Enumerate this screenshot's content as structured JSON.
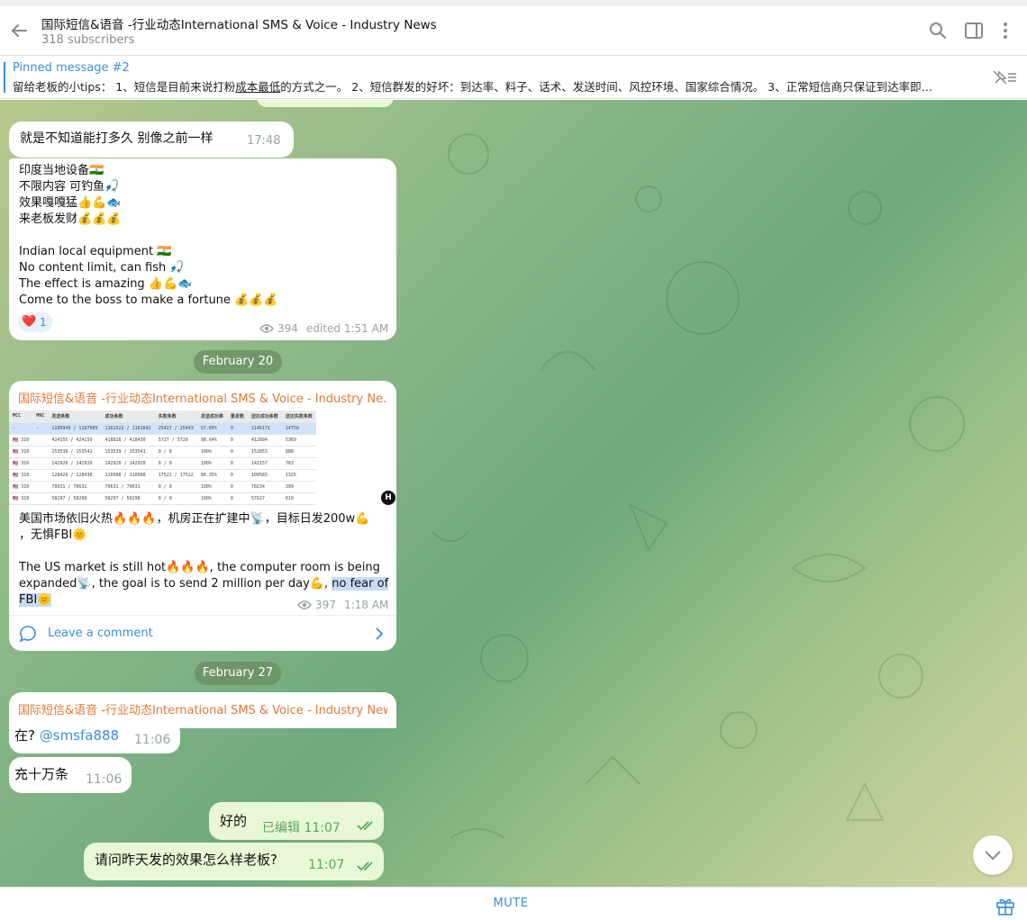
{
  "header": {
    "title": "国际短信&语音 -行业动态International SMS & Voice - Industry News",
    "subscribers": "318 subscribers"
  },
  "pinned": {
    "label": "Pinned message #2",
    "text_before": "留给老板的小tips： 1、短信是目前来说打粉",
    "text_underlined": "成本最低",
    "text_after": "的方式之一。 2、短信群发的好坏：到达率、料子、话术、发送时间、风控环境、国家综合情况。 3、正常短信商只保证到达率即…"
  },
  "messages": {
    "m0": {
      "text": "就是不知道能打多久 别像之前一样",
      "time": "17:48"
    },
    "m1": {
      "lines": [
        "印度当地设备🇮🇳",
        "不限内容 可钓鱼🎣",
        "效果嘎嘎猛👍💪🐟",
        "来老板发财💰💰💰",
        "Indian local equipment 🇮🇳",
        "No content limit, can fish 🎣",
        "The effect is amazing 👍💪🐟",
        "Come to the boss to make a fortune 💰💰💰"
      ],
      "reaction_emoji": "❤️",
      "reaction_count": "1",
      "views": "394",
      "meta": "edited 1:51 AM"
    },
    "date1": "February 20",
    "m2": {
      "channel": "国际短信&语音 -行业动态International SMS & Voice - Industry Ne...",
      "table_header": [
        "MCC",
        "MNC",
        "发送条数",
        "成功条数",
        "失败条数",
        "发送成功率",
        "重发数",
        "送达成功条数",
        "送达失败条数"
      ],
      "table_rows": [
        [
          "-",
          "-",
          "1186949 / 1187085",
          "1161522 / 1161642",
          "25427 / 25443",
          "97.85%",
          "0",
          "1146171",
          "14750"
        ],
        [
          "🇺🇸 310",
          "",
          "424155 / 424159",
          "418828 / 418430",
          "5727 / 5729",
          "98.64%",
          "0",
          "412684",
          "5369"
        ],
        [
          "🇺🇸 310",
          "",
          "153539 / 153541",
          "153539 / 153541",
          "0 / 0",
          "100%",
          "0",
          "152653",
          "888"
        ],
        [
          "🇺🇸 310",
          "",
          "142920 / 142920",
          "142920 / 142920",
          "0 / 0",
          "100%",
          "0",
          "142157",
          "763"
        ],
        [
          "🇺🇸 310",
          "",
          "128429 / 128430",
          "110908 / 110908",
          "17521 / 17522",
          "86.35%",
          "0",
          "109583",
          "1325"
        ],
        [
          "🇺🇸 310",
          "",
          "70631 / 70631",
          "70631 / 70631",
          "0 / 0",
          "100%",
          "0",
          "70234",
          "399"
        ],
        [
          "🇺🇸 310",
          "",
          "58297 / 58298",
          "58297 / 58298",
          "0 / 0",
          "100%",
          "0",
          "57627",
          "610"
        ]
      ],
      "line1": "美国市场依旧火热🔥🔥🔥，机房正在扩建中📡，目标日发200w💪",
      "line2": "，无惧FBI🌞",
      "line3": "The US market is still hot🔥🔥🔥, the computer room is being",
      "line4a": "expanded📡, the goal is to send 2 million per day💪, ",
      "line4b": "no fear of",
      "line5": "FBI🌞",
      "views": "397",
      "time": "1:18 AM",
      "comment": "Leave a comment"
    },
    "date2": "February 27",
    "m3": {
      "channel": "国际短信&语音 -行业动态International SMS & Voice - Industry New..."
    },
    "m4": {
      "text": "在?",
      "mention": "@smsfa888",
      "time": "11:06"
    },
    "m5": {
      "text": "充十万条",
      "time": "11:06"
    },
    "m6": {
      "text": "好的",
      "meta": "已编辑 11:07"
    },
    "m7": {
      "text": "请问昨天发的效果怎么样老板?",
      "time": "11:07"
    }
  },
  "footer": {
    "mute": "MUTE"
  },
  "icons": [
    "back-arrow-icon",
    "search-icon",
    "sidebar-toggle-icon",
    "more-vert-icon",
    "unpin-icon",
    "eye-icon",
    "comment-icon",
    "chevron-right-icon",
    "double-check-icon",
    "chevron-down-icon",
    "gift-icon"
  ],
  "colors": {
    "accent": "#3a8fd6",
    "channel_name": "#e07a34",
    "own_bubble": "#e8f8d6",
    "own_time": "#5aa560"
  }
}
